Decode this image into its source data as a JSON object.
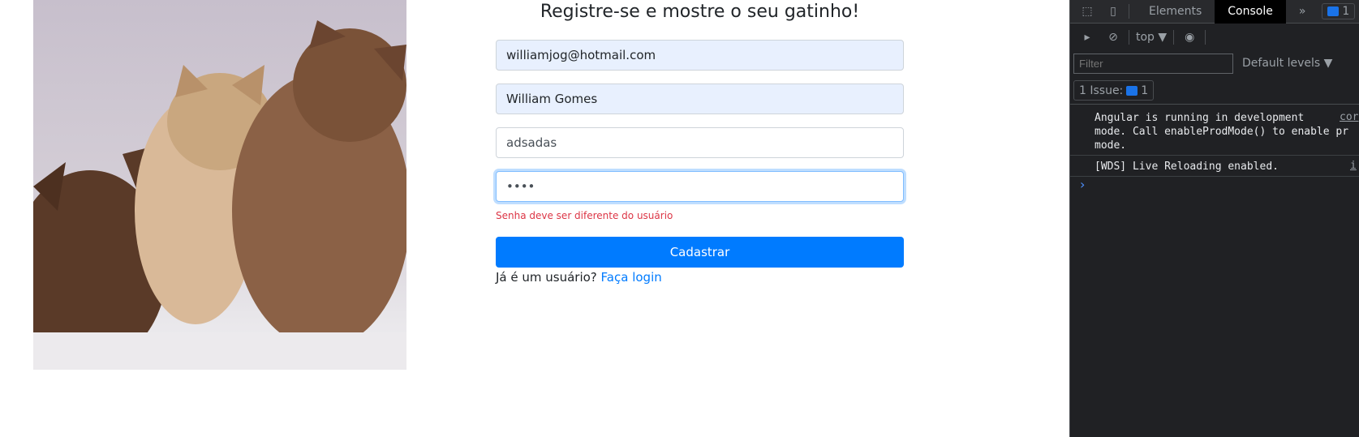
{
  "page": {
    "title": "Registre-se e mostre o seu gatinho!",
    "email_value": "williamjog@hotmail.com",
    "name_value": "William Gomes",
    "user_value": "adsadas",
    "password_value": "1234",
    "error": "Senha deve ser diferente do usuário",
    "submit_label": "Cadastrar",
    "login_prompt": "Já é um usuário?",
    "login_link": "Faça login"
  },
  "devtools": {
    "tabs": [
      "Elements",
      "Console"
    ],
    "more": "»",
    "issues_badge": "1",
    "context": "top ▼",
    "filter_placeholder": "Filter",
    "levels": "Default levels ▼",
    "issues_label": "1 Issue:",
    "issues_count": "1",
    "messages": [
      {
        "text": "Angular is running in development\nmode. Call enableProdMode() to enable pr\nmode.",
        "source": "cor"
      },
      {
        "text": "[WDS] Live Reloading enabled.",
        "source": "i"
      }
    ],
    "prompt": "›"
  }
}
